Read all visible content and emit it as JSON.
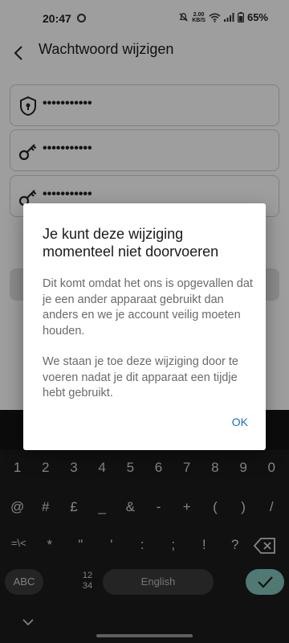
{
  "status_bar": {
    "time": "20:47",
    "net_speed_value": "2.00",
    "net_speed_unit": "KB/S",
    "battery": "65%"
  },
  "app_bar": {
    "title": "Wachtwoord wijzigen",
    "back_icon": "arrow-back-icon"
  },
  "form": {
    "fields": [
      {
        "icon": "shield-lock-icon",
        "value": "•••••••••••"
      },
      {
        "icon": "key-icon",
        "value": "•••••••••••"
      },
      {
        "icon": "key-icon",
        "value": "•••••••••••"
      }
    ]
  },
  "dialog": {
    "title": "Je kunt deze wijziging momenteel niet doorvoeren",
    "body_1": "Dit komt omdat het ons is opgevallen dat je een ander apparaat gebruikt dan anders en we je account veilig moeten houden.",
    "body_2": "We staan je toe deze wijziging door te voeren nadat je dit apparaat een tijdje hebt gebruikt.",
    "ok": "OK",
    "ok_color": "#1a6fbd"
  },
  "keyboard": {
    "row1": [
      "1",
      "2",
      "3",
      "4",
      "5",
      "6",
      "7",
      "8",
      "9",
      "0"
    ],
    "row2": [
      "@",
      "#",
      "£",
      "_",
      "&",
      "-",
      "+",
      "(",
      ")",
      "/"
    ],
    "row3": [
      "=\\<",
      "*",
      "\"",
      "'",
      ":",
      ";",
      "!",
      "?"
    ],
    "abc": "ABC",
    "num_top": "12",
    "num_bottom": "34",
    "space": "English",
    "enter_color": "#82c3bc"
  }
}
